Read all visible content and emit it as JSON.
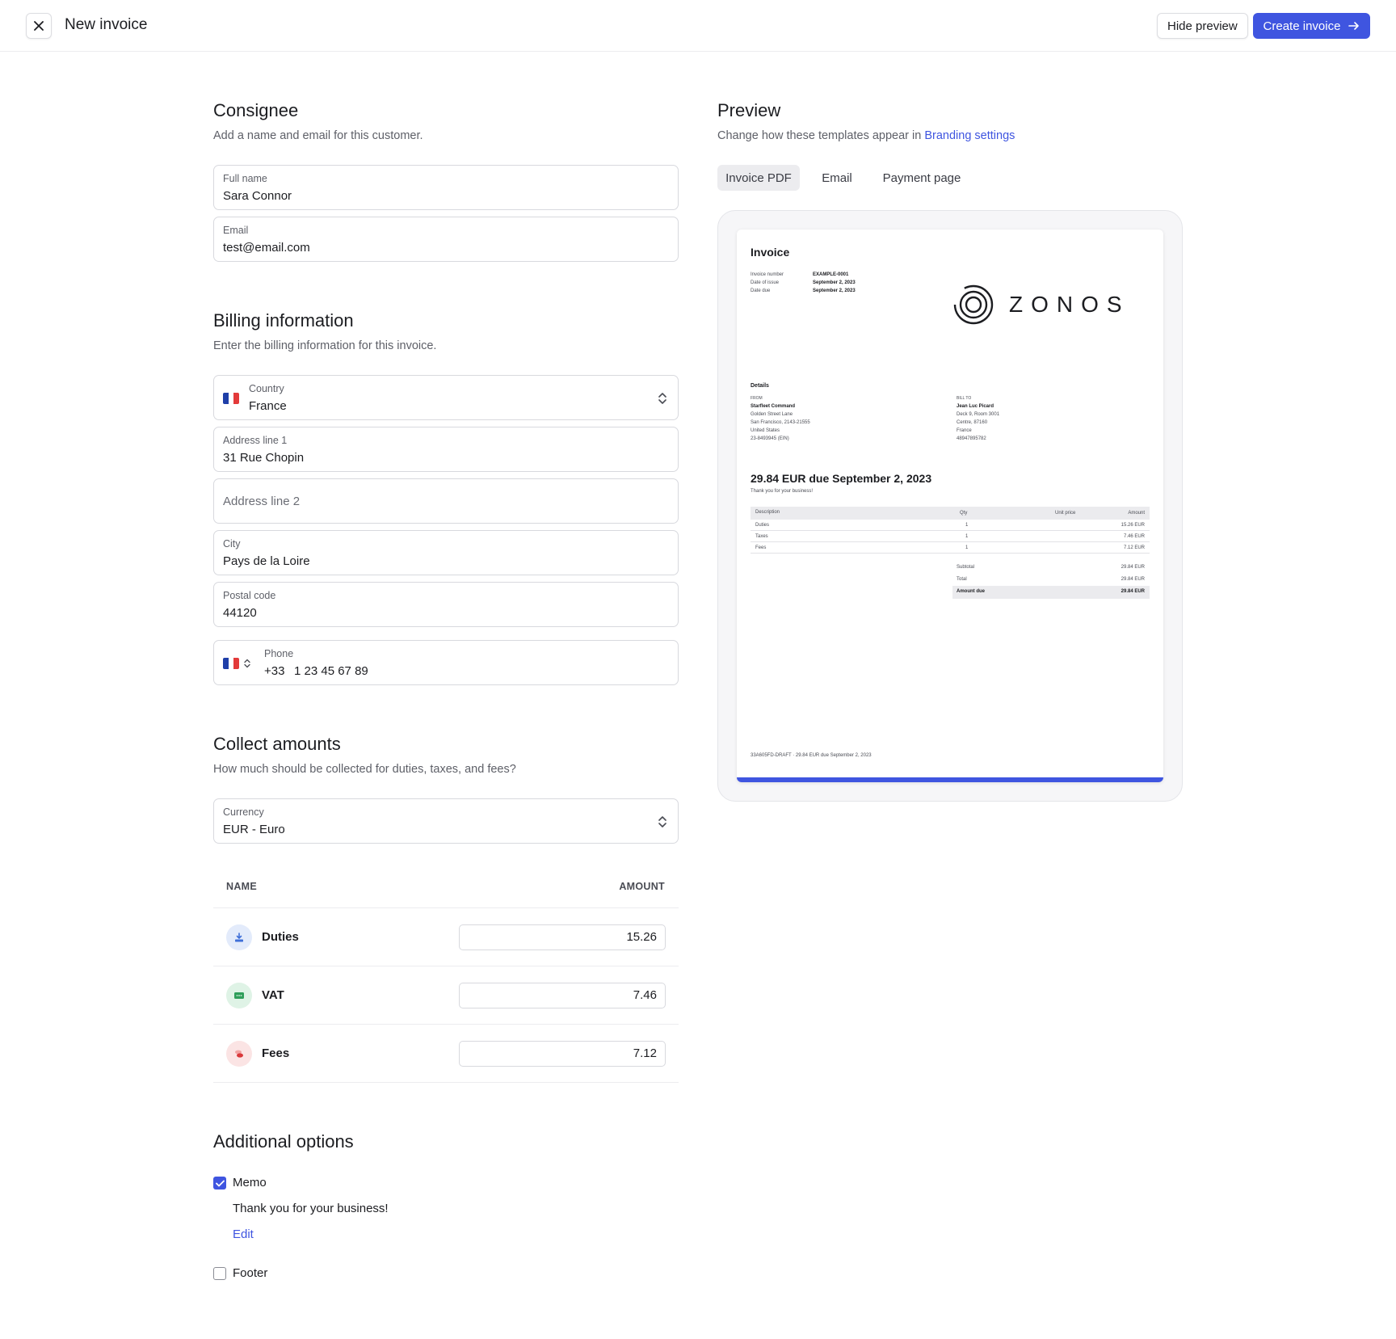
{
  "header": {
    "title": "New invoice",
    "hide_preview": "Hide preview",
    "create_invoice": "Create invoice"
  },
  "consignee": {
    "title": "Consignee",
    "subtitle": "Add a name and email for this customer.",
    "full_name_label": "Full name",
    "full_name_value": "Sara Connor",
    "email_label": "Email",
    "email_value": "test@email.com"
  },
  "billing": {
    "title": "Billing information",
    "subtitle": "Enter the billing information for this invoice.",
    "country_label": "Country",
    "country_value": "France",
    "address1_label": "Address line 1",
    "address1_value": "31 Rue Chopin",
    "address2_placeholder": "Address line 2",
    "city_label": "City",
    "city_value": "Pays de la Loire",
    "postal_label": "Postal code",
    "postal_value": "44120",
    "phone_label": "Phone",
    "phone_code": "+33",
    "phone_value": "1 23 45 67 89"
  },
  "collect": {
    "title": "Collect amounts",
    "subtitle": "How much should be collected for duties, taxes, and fees?",
    "currency_label": "Currency",
    "currency_value": "EUR - Euro",
    "col_name": "NAME",
    "col_amount": "AMOUNT",
    "rows": [
      {
        "name": "Duties",
        "amount": "15.26",
        "icon": "download-box-icon",
        "color": "#3f6fd8"
      },
      {
        "name": "VAT",
        "amount": "7.46",
        "icon": "receipt-icon",
        "color": "#2f9e5a"
      },
      {
        "name": "Fees",
        "amount": "7.12",
        "icon": "coins-icon",
        "color": "#d9383a"
      }
    ]
  },
  "options": {
    "title": "Additional options",
    "memo_label": "Memo",
    "memo_checked": true,
    "memo_text": "Thank you for your business!",
    "edit_link": "Edit",
    "footer_label": "Footer",
    "footer_checked": false
  },
  "preview": {
    "title": "Preview",
    "subtitle_prefix": "Change how these templates appear in",
    "subtitle_link": "Branding settings",
    "tabs": [
      "Invoice PDF",
      "Email",
      "Payment page"
    ],
    "active_tab": "Invoice PDF"
  },
  "invoice_doc": {
    "title": "Invoice",
    "meta": [
      {
        "label": "Invoice number",
        "value": "EXAMPLE-0001"
      },
      {
        "label": "Date of issue",
        "value": "September 2, 2023"
      },
      {
        "label": "Date due",
        "value": "September 2, 2023"
      }
    ],
    "logo_text": "ZONOS",
    "details_title": "Details",
    "from_label": "FROM",
    "from_lines": [
      "Starfleet Command",
      "Golden Street Lane",
      "San Francisco, 2143-21555",
      "United States",
      "23-8493945 (EIN)"
    ],
    "bill_to_label": "BILL TO",
    "bill_to_lines": [
      "Jean Luc Picard",
      "Deck 9, Room 3001",
      "Centre, 87160",
      "France",
      "48947895782"
    ],
    "amount_due_heading": "29.84 EUR due September 2, 2023",
    "thank_you": "Thank you for your business!",
    "table_headers": [
      "Description",
      "Qty",
      "Unit price",
      "Amount"
    ],
    "table_rows": [
      {
        "desc": "Duties",
        "qty": "1",
        "amount": "15.26 EUR"
      },
      {
        "desc": "Taxes",
        "qty": "1",
        "amount": "7.46 EUR"
      },
      {
        "desc": "Fees",
        "qty": "1",
        "amount": "7.12 EUR"
      }
    ],
    "subtotal_label": "Subtotal",
    "subtotal_value": "29.84 EUR",
    "total_label": "Total",
    "total_value": "29.84 EUR",
    "amount_due_label": "Amount due",
    "amount_due_value": "29.84 EUR",
    "footer_line": "33A605FD-DRAFT · 29.84 EUR due September 2, 2023"
  },
  "colors": {
    "accent": "#3f55e0",
    "border": "#d8d9de"
  }
}
